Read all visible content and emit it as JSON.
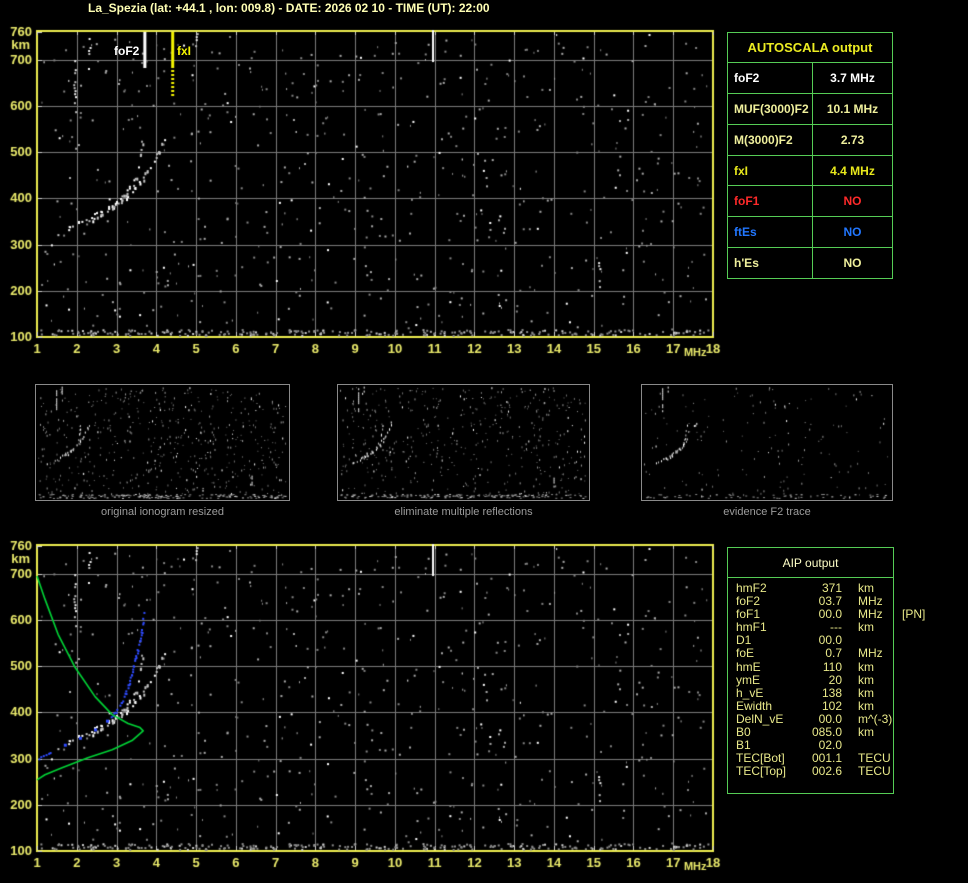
{
  "header": {
    "title": "La_Spezia (lat: +44.1 , lon: 009.8) - DATE: 2026 02 10 - TIME (UT): 22:00"
  },
  "colors": {
    "background": "#000000",
    "axis_border_yellow": "#EDED4F",
    "axis_label_yellow": "#E9E96A",
    "grid_gray": "#7a7a7a",
    "table_border_green": "#55CC55",
    "title_cream": "#FFFFB4",
    "trace_white": "#FFFFFF",
    "profile_green": "#00D435",
    "scaled_trace_blue": "#2E4BFF",
    "caption_gray": "#9C9C9C",
    "marker_fof2": "#FFFFFF",
    "marker_fxi": "#F5F500"
  },
  "ionogram_labels": {
    "fof2": "foF2",
    "fxi": "fxI"
  },
  "thumbnails": [
    {
      "caption": "original ionogram resized"
    },
    {
      "caption": "eliminate multiple reflections"
    },
    {
      "caption": "evidence F2 trace"
    }
  ],
  "autoscala": {
    "title": "AUTOSCALA output",
    "title_color": "#ECEC22",
    "rows": [
      {
        "label": "foF2",
        "value": "3.7 MHz",
        "color": "#FFFFFF"
      },
      {
        "label": "MUF(3000)F2",
        "value": "10.1 MHz",
        "color": "#EFEF9C"
      },
      {
        "label": "M(3000)F2",
        "value": "2.73",
        "color": "#EFEF9C"
      },
      {
        "label": "fxI",
        "value": "4.4 MHz",
        "color": "#E8E81C"
      },
      {
        "label": "foF1",
        "value": "NO",
        "color": "#FF2A2A"
      },
      {
        "label": "ftEs",
        "value": "NO",
        "color": "#2277FF"
      },
      {
        "label": "h'Es",
        "value": "NO",
        "color": "#EFEF9C"
      }
    ]
  },
  "aip": {
    "title": "AIP output",
    "title_color": "#FFFFC8",
    "rows": [
      {
        "name": "hmF2",
        "value": "371",
        "unit": "km",
        "extra": ""
      },
      {
        "name": "foF2",
        "value": "03.7",
        "unit": "MHz",
        "extra": ""
      },
      {
        "name": "foF1",
        "value": "00.0",
        "unit": "MHz",
        "extra": "[PN]"
      },
      {
        "name": "hmF1",
        "value": "---",
        "unit": "km",
        "extra": ""
      },
      {
        "name": "D1",
        "value": "00.0",
        "unit": "",
        "extra": ""
      },
      {
        "name": "foE",
        "value": "0.7",
        "unit": "MHz",
        "extra": ""
      },
      {
        "name": "hmE",
        "value": "110",
        "unit": "km",
        "extra": ""
      },
      {
        "name": "ymE",
        "value": "20",
        "unit": "km",
        "extra": ""
      },
      {
        "name": "h_vE",
        "value": "138",
        "unit": "km",
        "extra": ""
      },
      {
        "name": "Ewidth",
        "value": "102",
        "unit": "km",
        "extra": ""
      },
      {
        "name": "DelN_vE",
        "value": "00.0",
        "unit": "m^(-3)",
        "extra": ""
      },
      {
        "name": "B0",
        "value": "085.0",
        "unit": "km",
        "extra": ""
      },
      {
        "name": "B1",
        "value": "02.0",
        "unit": "",
        "extra": ""
      },
      {
        "name": "TEC[Bot]",
        "value": "001.1",
        "unit": "TECU",
        "extra": ""
      },
      {
        "name": "TEC[Top]",
        "value": "002.6",
        "unit": "TECU",
        "extra": ""
      }
    ]
  },
  "chart_data": [
    {
      "id": "iono-top",
      "type": "scatter",
      "title": "ionogram with AUTOSCALA markers",
      "xlabel": "MHz",
      "ylabel": "km",
      "xlim": [
        1,
        18
      ],
      "ylim": [
        100,
        765
      ],
      "x_ticks": [
        1,
        2,
        3,
        4,
        5,
        6,
        7,
        8,
        9,
        10,
        11,
        12,
        13,
        14,
        15,
        16,
        17,
        18
      ],
      "y_ticks": [
        760,
        700,
        600,
        500,
        400,
        300,
        200,
        100
      ],
      "grid": true,
      "annotations": [
        {
          "label": "foF2",
          "f": 3.7,
          "color": "#FFFFFF",
          "len": 37
        },
        {
          "label": "fxI",
          "f": 4.4,
          "color": "#F5F500",
          "len": 64
        }
      ],
      "series": [
        {
          "name": "F2 trace ordinary",
          "color": "#FFFFFF",
          "points": [
            [
              1.53,
              325
            ],
            [
              1.83,
              338
            ],
            [
              2.21,
              355
            ],
            [
              2.58,
              373
            ],
            [
              2.89,
              388
            ],
            [
              3.14,
              405
            ],
            [
              3.34,
              425
            ],
            [
              3.47,
              446
            ],
            [
              3.54,
              470
            ],
            [
              3.59,
              494
            ],
            [
              3.62,
              518
            ]
          ]
        },
        {
          "name": "F2 trace extraordinary",
          "color": "#FFFFFF",
          "points": [
            [
              2.28,
              351
            ],
            [
              2.58,
              366
            ],
            [
              2.89,
              381
            ],
            [
              3.14,
              396
            ],
            [
              3.39,
              416
            ],
            [
              3.59,
              438
            ],
            [
              3.77,
              461
            ],
            [
              3.92,
              483
            ],
            [
              4.04,
              502
            ],
            [
              4.14,
              518
            ],
            [
              4.22,
              528
            ]
          ]
        }
      ],
      "streaks": [
        {
          "f": 1.96,
          "km": [
            587,
            699
          ],
          "bright": false
        },
        {
          "f": 2.33,
          "km": [
            667,
            747
          ],
          "bright": false
        },
        {
          "f": 5.02,
          "km": [
            730,
            764
          ],
          "bright": false
        },
        {
          "f": 10.96,
          "km": [
            695,
            764
          ],
          "bright": true
        },
        {
          "f": 15.16,
          "km": [
            208,
            262
          ],
          "bright": false
        }
      ],
      "noise": {
        "seed": 42,
        "count": 620,
        "bottom_band": 260
      }
    },
    {
      "id": "iono-bottom",
      "type": "scatter",
      "title": "ionogram with AIP profile",
      "xlabel": "MHz",
      "ylabel": "km",
      "xlim": [
        1,
        18
      ],
      "ylim": [
        100,
        765
      ],
      "x_ticks": [
        1,
        2,
        3,
        4,
        5,
        6,
        7,
        8,
        9,
        10,
        11,
        12,
        13,
        14,
        15,
        16,
        17,
        18
      ],
      "y_ticks": [
        760,
        700,
        600,
        500,
        400,
        300,
        200,
        100
      ],
      "grid": true,
      "annotations": [],
      "series": [
        {
          "name": "F2 trace ordinary",
          "color": "#FFFFFF",
          "points": [
            [
              1.53,
              325
            ],
            [
              1.83,
              338
            ],
            [
              2.21,
              355
            ],
            [
              2.58,
              373
            ],
            [
              2.89,
              388
            ],
            [
              3.14,
              405
            ],
            [
              3.34,
              425
            ],
            [
              3.47,
              446
            ],
            [
              3.54,
              470
            ],
            [
              3.59,
              494
            ],
            [
              3.62,
              518
            ]
          ]
        },
        {
          "name": "F2 trace extraordinary",
          "color": "#FFFFFF",
          "points": [
            [
              2.28,
              351
            ],
            [
              2.58,
              366
            ],
            [
              2.89,
              381
            ],
            [
              3.14,
              396
            ],
            [
              3.39,
              416
            ],
            [
              3.59,
              438
            ],
            [
              3.77,
              461
            ],
            [
              3.92,
              483
            ],
            [
              4.04,
              502
            ],
            [
              4.14,
              518
            ],
            [
              4.22,
              528
            ]
          ]
        },
        {
          "name": "scaled trace",
          "color": "#2E4BFF",
          "style": "dots",
          "points": [
            [
              1.03,
              302
            ],
            [
              1.33,
              315
            ],
            [
              1.7,
              330
            ],
            [
              2.08,
              345
            ],
            [
              2.46,
              363
            ],
            [
              2.76,
              382
            ],
            [
              2.96,
              402
            ],
            [
              3.11,
              421
            ],
            [
              3.21,
              441
            ],
            [
              3.29,
              460
            ],
            [
              3.36,
              482
            ],
            [
              3.41,
              502
            ],
            [
              3.47,
              519
            ],
            [
              3.52,
              536
            ],
            [
              3.57,
              556
            ],
            [
              3.62,
              575
            ],
            [
              3.64,
              597
            ],
            [
              3.69,
              617
            ]
          ]
        },
        {
          "name": "electron density profile",
          "color": "#00D435",
          "style": "line",
          "points": [
            [
              1.0,
              695
            ],
            [
              1.2,
              645
            ],
            [
              1.53,
              569
            ],
            [
              1.96,
              497
            ],
            [
              2.46,
              434
            ],
            [
              2.89,
              395
            ],
            [
              3.29,
              376
            ],
            [
              3.59,
              367
            ],
            [
              3.67,
              360
            ],
            [
              3.39,
              339
            ],
            [
              2.89,
              319
            ],
            [
              2.28,
              302
            ],
            [
              1.63,
              280
            ],
            [
              1.2,
              265
            ],
            [
              1.0,
              254
            ]
          ]
        }
      ],
      "streaks": [
        {
          "f": 1.96,
          "km": [
            587,
            699
          ],
          "bright": false
        },
        {
          "f": 2.33,
          "km": [
            667,
            747
          ],
          "bright": false
        },
        {
          "f": 5.02,
          "km": [
            730,
            764
          ],
          "bright": false
        },
        {
          "f": 10.96,
          "km": [
            695,
            764
          ],
          "bright": true
        },
        {
          "f": 15.16,
          "km": [
            208,
            262
          ],
          "bright": false
        }
      ],
      "noise": {
        "seed": 42,
        "count": 620,
        "bottom_band": 260
      }
    }
  ],
  "thumb_render": [
    {
      "seed": 101,
      "count": 520,
      "band": 170,
      "streak_limit": 5
    },
    {
      "seed": 202,
      "count": 460,
      "band": 150,
      "streak_limit": 5
    },
    {
      "seed": 303,
      "count": 150,
      "band": 60,
      "streak_limit": 2
    }
  ]
}
